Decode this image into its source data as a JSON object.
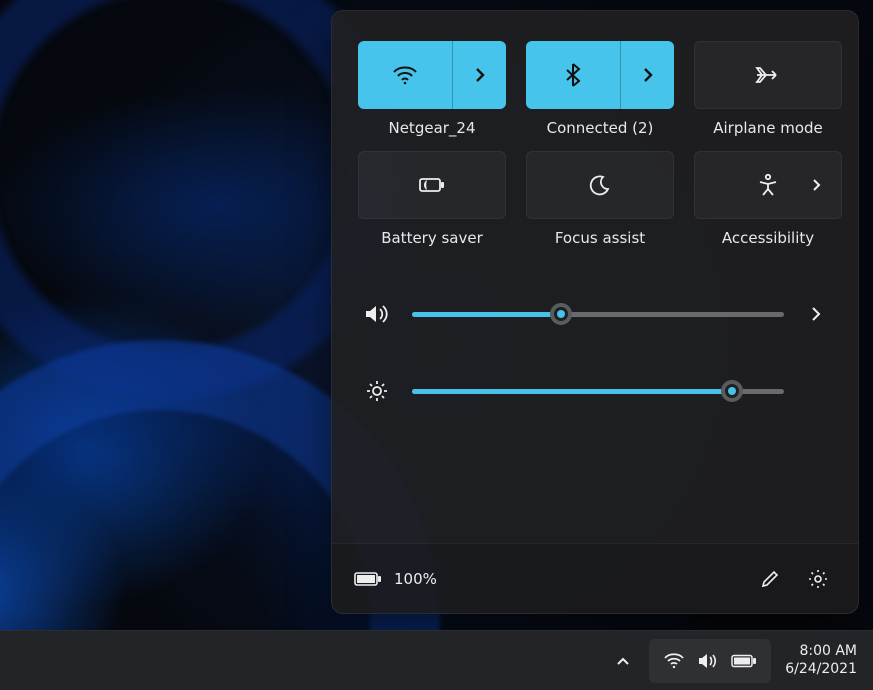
{
  "colors": {
    "accent": "#47c4eb"
  },
  "tiles": {
    "wifi": {
      "label": "Netgear_24",
      "active": true,
      "has_expand": true
    },
    "bluetooth": {
      "label": "Connected (2)",
      "active": true,
      "has_expand": true
    },
    "airplane": {
      "label": "Airplane mode",
      "active": false,
      "has_expand": false
    },
    "battsaver": {
      "label": "Battery saver",
      "active": false,
      "has_expand": false
    },
    "focus": {
      "label": "Focus assist",
      "active": false,
      "has_expand": false
    },
    "access": {
      "label": "Accessibility",
      "active": false,
      "has_expand": true
    }
  },
  "sliders": {
    "volume": {
      "percent": 40
    },
    "brightness": {
      "percent": 86
    }
  },
  "footer": {
    "battery_text": "100%"
  },
  "taskbar": {
    "time": "8:00 AM",
    "date": "6/24/2021"
  }
}
